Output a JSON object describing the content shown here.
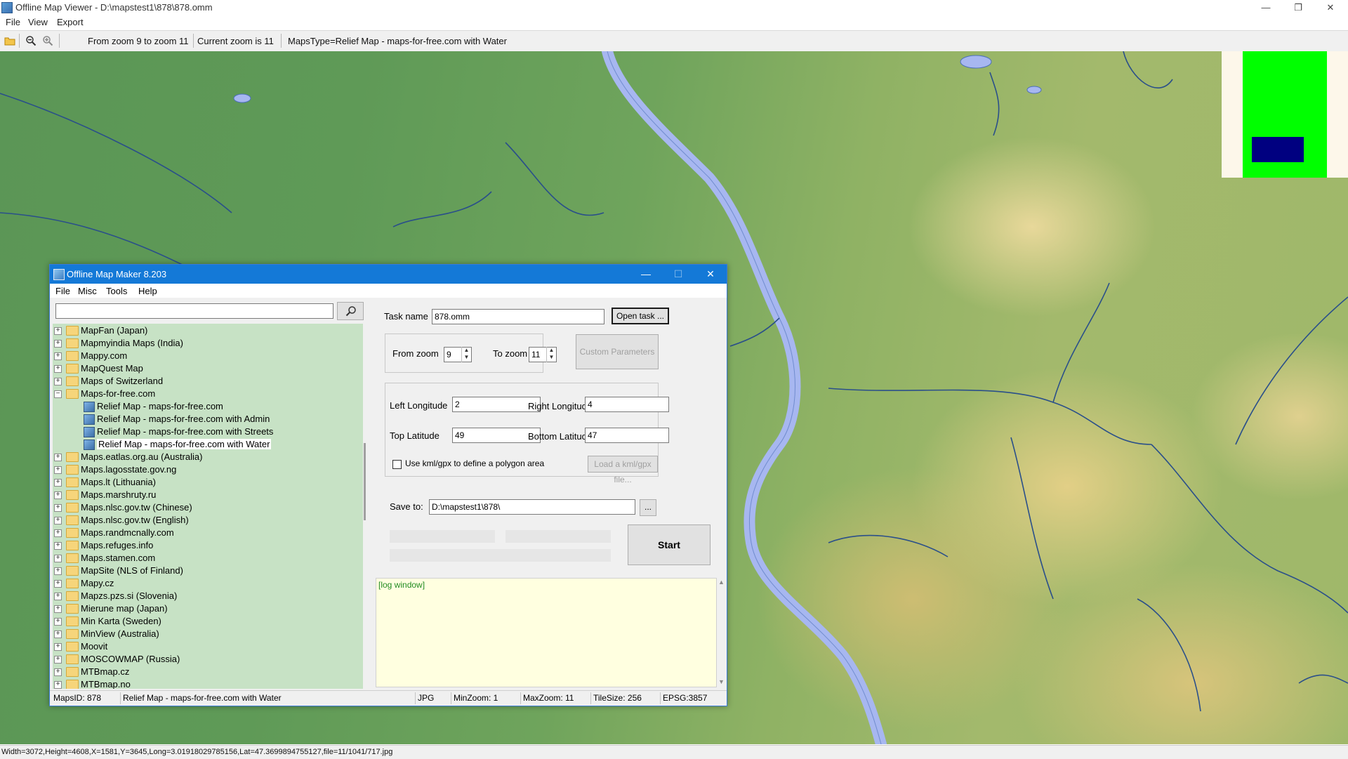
{
  "viewer": {
    "title": "Offline Map Viewer - D:\\mapstest1\\878\\878.omm",
    "caption_min": "—",
    "caption_max": "❐",
    "caption_close": "✕",
    "menu": [
      "File",
      "View",
      "Export"
    ],
    "toolbar": {
      "zoom_range": "From zoom 9 to zoom 11",
      "current_zoom": "Current zoom is 11",
      "maps_type": "MapsType=Relief Map - maps-for-free.com with Water"
    },
    "status": "Width=3072,Height=4608,X=1581,Y=3645,Long=3.01918029785156,Lat=47.3699894755127,file=11/1041/717.jpg"
  },
  "colors": {
    "map_water": "#a7b7f0",
    "tree_bg": "#c7e2c5",
    "title_blue": "#1479d7",
    "minimap_green": "#00ff00",
    "minimap_view": "#000080"
  },
  "dialog": {
    "title": "Offline Map Maker 8.203",
    "caption_min": "—",
    "caption_max": "☐",
    "caption_close": "✕",
    "menu": [
      "File",
      "Misc",
      "Tools",
      "Help"
    ],
    "search": {
      "value": "",
      "icon": "search-icon"
    },
    "tree": [
      {
        "label": "MapFan (Japan)",
        "type": "folder"
      },
      {
        "label": "Mapmyindia Maps (India)",
        "type": "folder"
      },
      {
        "label": "Mappy.com",
        "type": "folder"
      },
      {
        "label": "MapQuest Map",
        "type": "folder"
      },
      {
        "label": "Maps of Switzerland",
        "type": "folder"
      },
      {
        "label": "Maps-for-free.com",
        "type": "folder-open",
        "expand": "−"
      },
      {
        "label": "Relief Map - maps-for-free.com",
        "type": "map"
      },
      {
        "label": "Relief Map - maps-for-free.com with Admin",
        "type": "map"
      },
      {
        "label": "Relief Map - maps-for-free.com with Streets",
        "type": "map"
      },
      {
        "label": "Relief Map - maps-for-free.com with Water",
        "type": "map",
        "selected": true
      },
      {
        "label": "Maps.eatlas.org.au (Australia)",
        "type": "folder"
      },
      {
        "label": "Maps.lagosstate.gov.ng",
        "type": "folder"
      },
      {
        "label": "Maps.lt (Lithuania)",
        "type": "folder"
      },
      {
        "label": "Maps.marshruty.ru",
        "type": "folder"
      },
      {
        "label": "Maps.nlsc.gov.tw (Chinese)",
        "type": "folder"
      },
      {
        "label": "Maps.nlsc.gov.tw (English)",
        "type": "folder"
      },
      {
        "label": "Maps.randmcnally.com",
        "type": "folder"
      },
      {
        "label": "Maps.refuges.info",
        "type": "folder"
      },
      {
        "label": "Maps.stamen.com",
        "type": "folder"
      },
      {
        "label": "MapSite (NLS of Finland)",
        "type": "folder"
      },
      {
        "label": "Mapy.cz",
        "type": "folder"
      },
      {
        "label": "Mapzs.pzs.si (Slovenia)",
        "type": "folder"
      },
      {
        "label": "Mierune map (Japan)",
        "type": "folder"
      },
      {
        "label": "Min Karta (Sweden)",
        "type": "folder"
      },
      {
        "label": "MinView (Australia)",
        "type": "folder"
      },
      {
        "label": "Moovit",
        "type": "folder"
      },
      {
        "label": "MOSCOWMAP (Russia)",
        "type": "folder"
      },
      {
        "label": "MTBmap.cz",
        "type": "folder"
      },
      {
        "label": "MTBmap.no",
        "type": "folder"
      }
    ],
    "form": {
      "task_name_label": "Task name",
      "task_name_value": "878.omm",
      "open_task": "Open task ...",
      "from_zoom_label": "From zoom",
      "from_zoom_value": "9",
      "to_zoom_label": "To zoom",
      "to_zoom_value": "11",
      "custom_params": "Custom Parameters",
      "left_lon_label": "Left Longitude",
      "left_lon_value": "2",
      "right_lon_label": "Right Longitude",
      "right_lon_value": "4",
      "top_lat_label": "Top Latitude",
      "top_lat_value": "49",
      "bottom_lat_label": "Bottom Latitude",
      "bottom_lat_value": "47",
      "kml_checkbox_label": "Use kml/gpx to define a polygon area",
      "kml_checked": false,
      "load_kml": "Load a kml/gpx file...",
      "save_to_label": "Save to:",
      "save_to_value": "D:\\mapstest1\\878\\",
      "browse": "...",
      "start": "Start",
      "log": "[log window]"
    },
    "status": {
      "maps_id": "MapsID: 878",
      "map_name": "Relief Map - maps-for-free.com with Water",
      "format": "JPG",
      "min_zoom": "MinZoom: 1",
      "max_zoom": "MaxZoom: 11",
      "tile_size": "TileSize: 256",
      "epsg": "EPSG:3857"
    }
  }
}
